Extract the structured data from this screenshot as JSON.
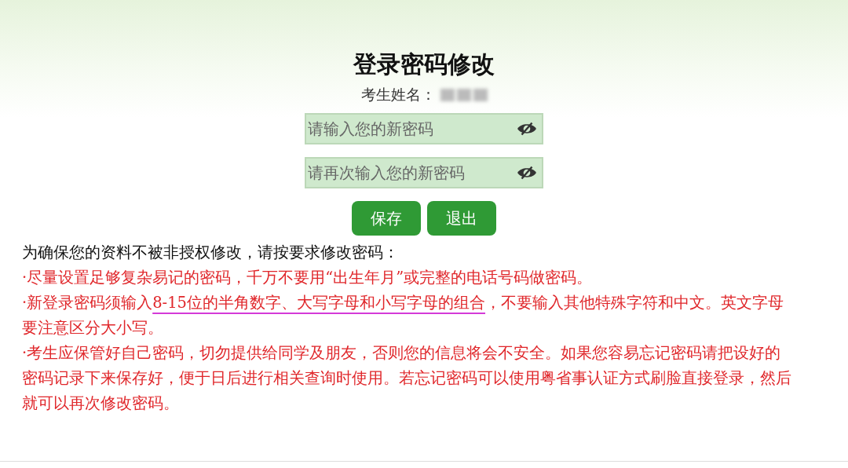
{
  "title": "登录密码修改",
  "name_label": "考生姓名：",
  "fields": [
    {
      "placeholder": "请输入您的新密码"
    },
    {
      "placeholder": "请再次输入您的新密码"
    }
  ],
  "buttons": [
    "保存",
    "退出"
  ],
  "intro": "为确保您的资料不被非授权修改，请按要求修改密码：",
  "notes": [
    {
      "text": "·尽量设置足够复杂易记的密码，千万不要用“出生年月”或完整的电话号码做密码。"
    },
    {
      "text": "·新登录密码须输入",
      "underlined_text": "8-15位的半角数字、大写字母和小写字母的组合",
      "text_after": "，不要输入其他特殊字符和中文。英文字母要注意区分大小写。"
    },
    {
      "text": "·考生应保管好自己密码，切勿提供给同学及朋友，否则您的信息将会不安全。如果您容易忘记密码请把设好的密码记录下来保存好，便于日后进行相关查询时使用。若忘记密码可以使用粤省事认证方式刷脸直接登录，然后就可以再次修改密码。"
    }
  ]
}
